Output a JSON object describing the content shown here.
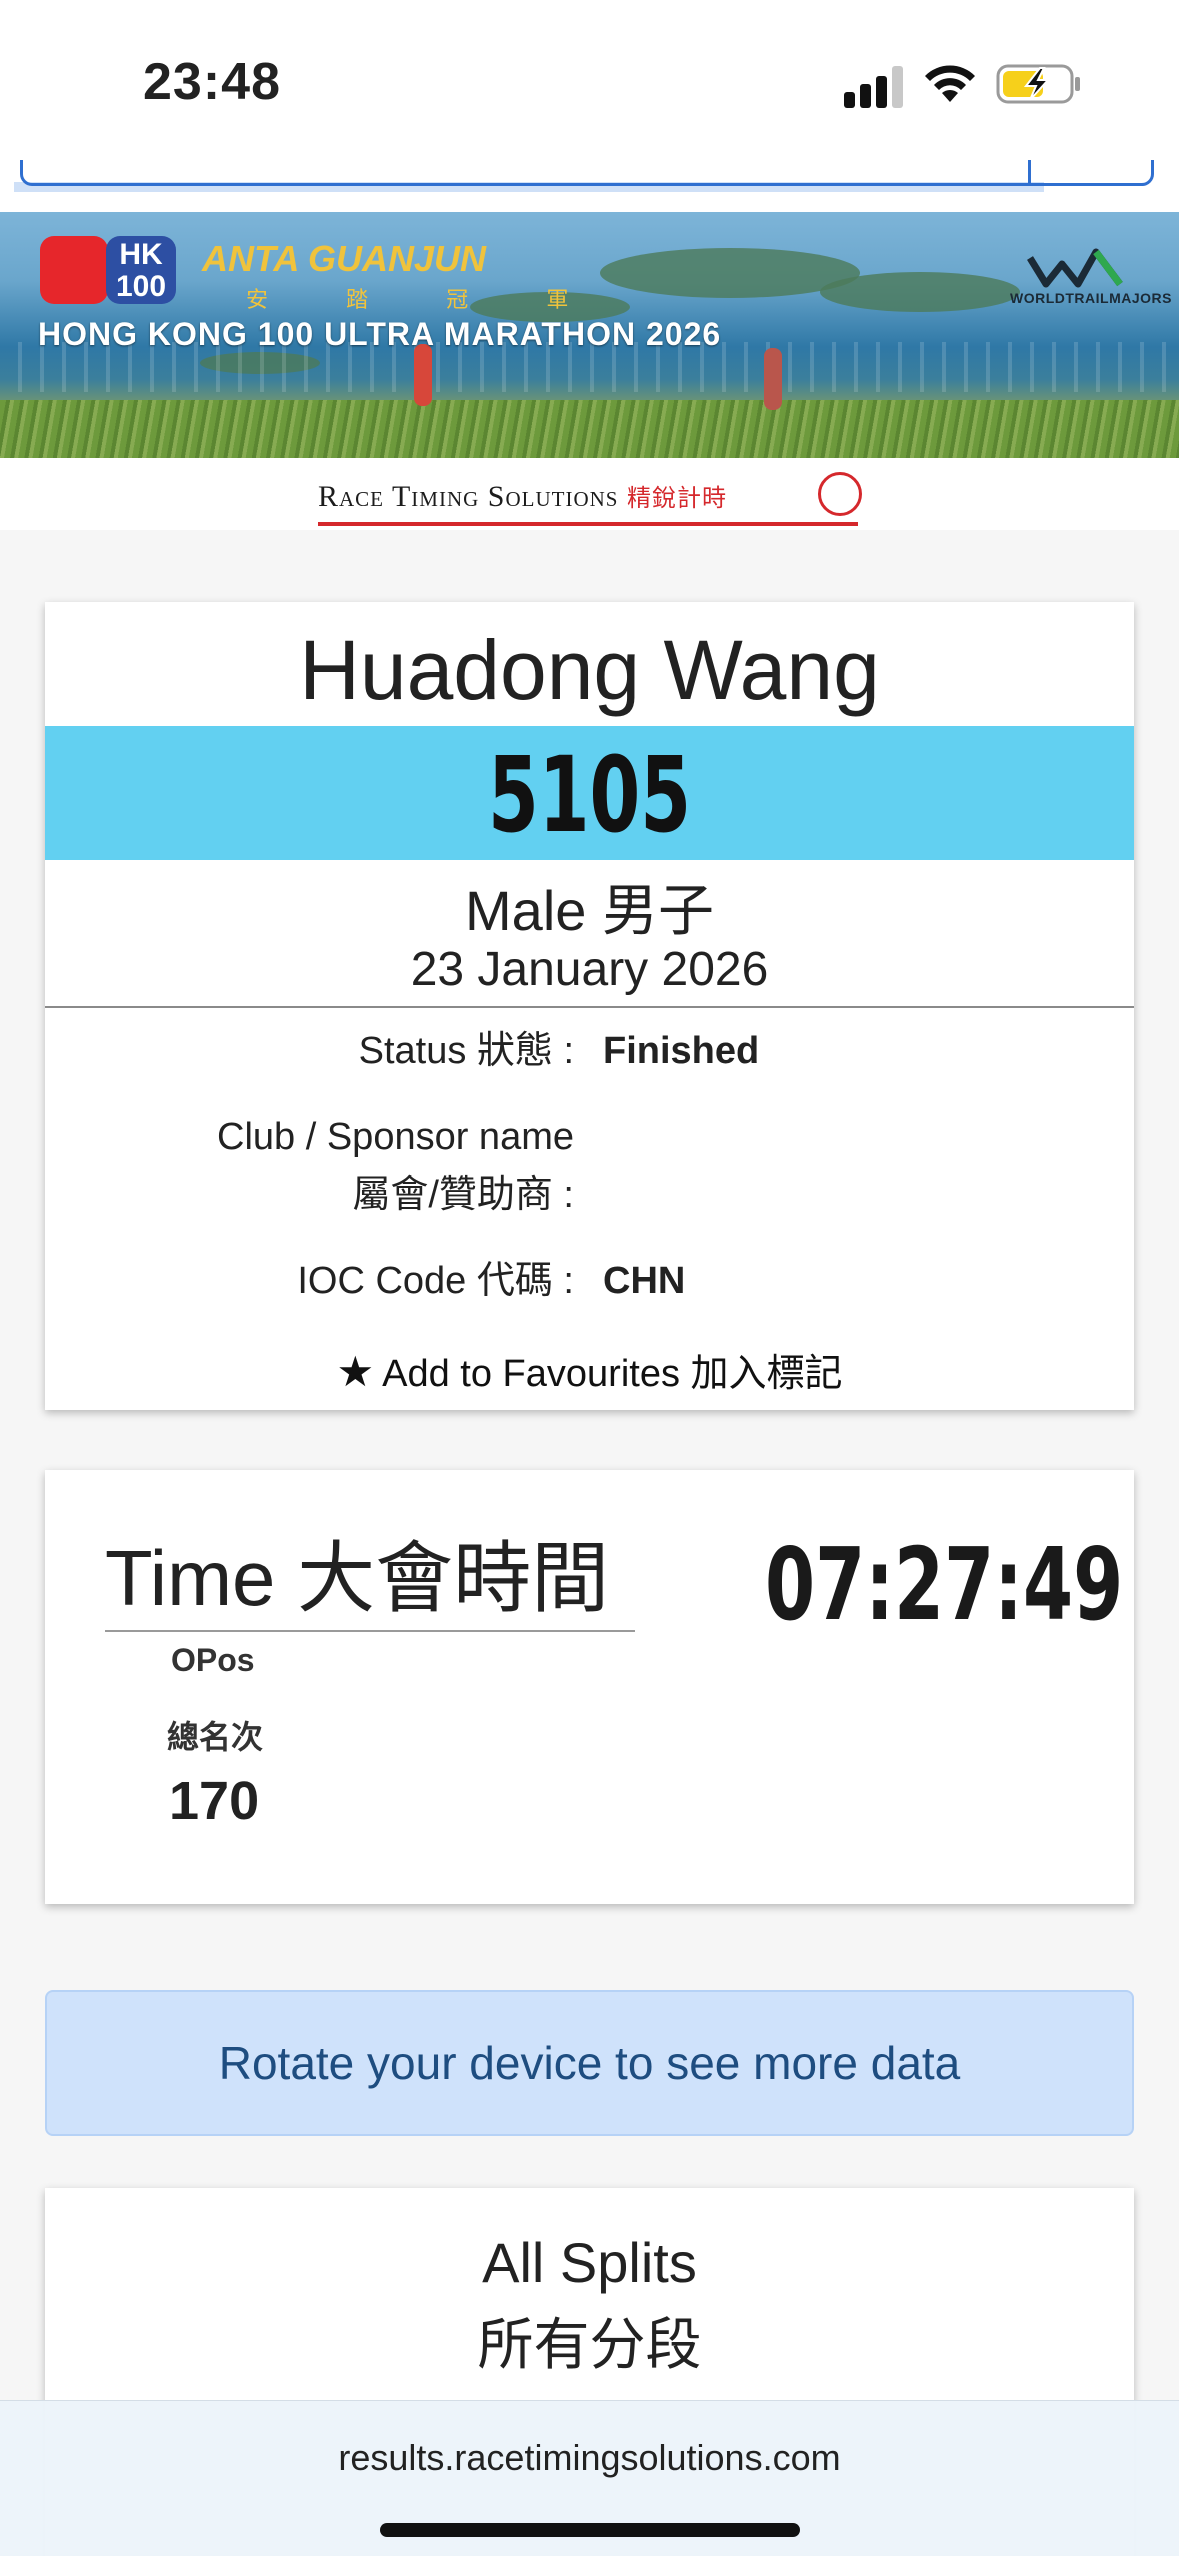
{
  "status_bar": {
    "time": "23:48",
    "icons": [
      "cellular-signal-icon",
      "wifi-icon",
      "battery-charging-icon"
    ],
    "battery_color": "#f6d01b"
  },
  "banner": {
    "hk_logo_text": "HK 100",
    "sponsor": "ANTA GUANJUN",
    "sponsor_cn": "安 踏 冠 軍",
    "title": "HONG KONG 100 ULTRA MARATHON 2026",
    "partner_logo": "WORLDTRAILMAJORS"
  },
  "timing_logo": {
    "text": "Race Timing Solutions",
    "text_cn": "精銳計時",
    "accent": "#d5282c"
  },
  "athlete": {
    "name": "Huadong Wang",
    "bib": "5105",
    "gender": "Male 男子",
    "date": "23 January 2026",
    "status_label": "Status 狀態 :",
    "status_value": "Finished",
    "club_label_line1": "Club / Sponsor name",
    "club_label_line2": "屬會/贊助商 :",
    "club_value": "",
    "ioc_label": "IOC Code 代碼 :",
    "ioc_value": "CHN",
    "favourite_label": "Add to Favourites 加入標記",
    "bib_band_color": "#62d0f1"
  },
  "result": {
    "title": "Time 大會時間",
    "time": "07:27:49",
    "opos_label": "OPos",
    "opos_label_cn": "總名次",
    "opos_value": "170"
  },
  "notice": {
    "text": "Rotate your device to see more data"
  },
  "splits": {
    "title": "All Splits",
    "title_cn": "所有分段"
  },
  "browser": {
    "url": "results.racetimingsolutions.com"
  }
}
